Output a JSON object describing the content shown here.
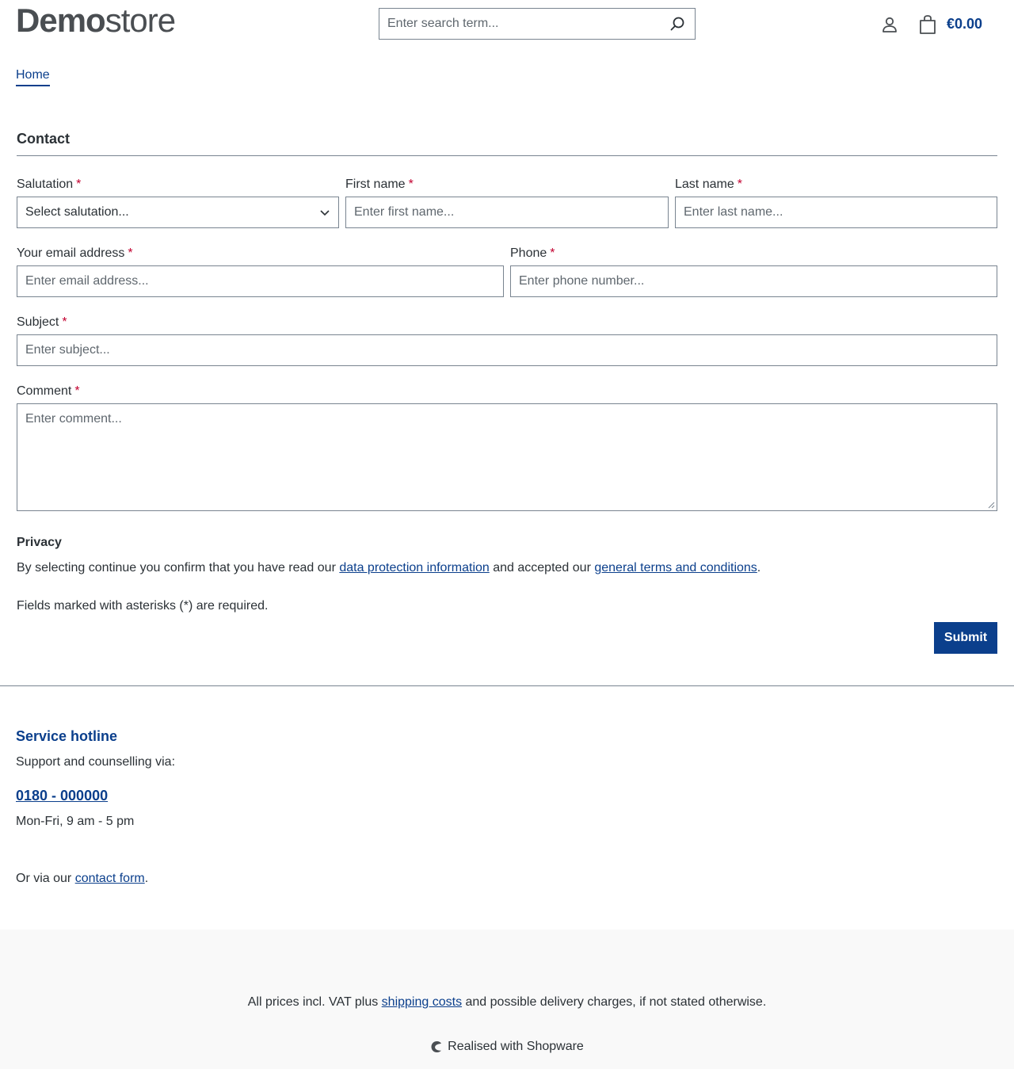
{
  "header": {
    "logo_bold": "Demo",
    "logo_light": "store",
    "search_placeholder": "Enter search term...",
    "cart_total": "€0.00"
  },
  "breadcrumb": {
    "home": "Home"
  },
  "contact": {
    "title": "Contact",
    "asterisk": "*",
    "salutation": {
      "label": "Salutation",
      "value": "Select salutation..."
    },
    "first_name": {
      "label": "First name",
      "placeholder": "Enter first name..."
    },
    "last_name": {
      "label": "Last name",
      "placeholder": "Enter last name..."
    },
    "email": {
      "label": "Your email address",
      "placeholder": "Enter email address..."
    },
    "phone": {
      "label": "Phone",
      "placeholder": "Enter phone number..."
    },
    "subject": {
      "label": "Subject",
      "placeholder": "Enter subject..."
    },
    "comment": {
      "label": "Comment",
      "placeholder": "Enter comment..."
    },
    "privacy": {
      "title": "Privacy",
      "text_1": "By selecting continue you confirm that you have read our ",
      "link_1": "data protection information",
      "text_2": " and accepted our ",
      "link_2": "general terms and conditions",
      "text_3": "."
    },
    "required_note": "Fields marked with asterisks (*) are required.",
    "submit_label": "Submit"
  },
  "footer": {
    "hotline_title": "Service hotline",
    "hotline_sub": "Support and counselling via:",
    "hotline_phone": "0180 - 000000",
    "hotline_hours": "Mon-Fri, 9 am - 5 pm",
    "via_text": "Or via our ",
    "via_link": "contact form",
    "via_end": ".",
    "vat_text_1": "All prices incl. VAT plus ",
    "vat_link": "shipping costs",
    "vat_text_2": " and possible delivery charges, if not stated otherwise.",
    "realised": "Realised with Shopware"
  },
  "icons": {
    "search": "search-icon",
    "account": "user-icon",
    "cart": "shopping-bag-icon",
    "select": "chevron-down-icon",
    "shopware": "shopware-logo-icon"
  },
  "colors": {
    "primary": "#0b3f8c",
    "required": "#c2002f",
    "text": "#2b3136",
    "footer_bg": "#f9f9f9"
  }
}
